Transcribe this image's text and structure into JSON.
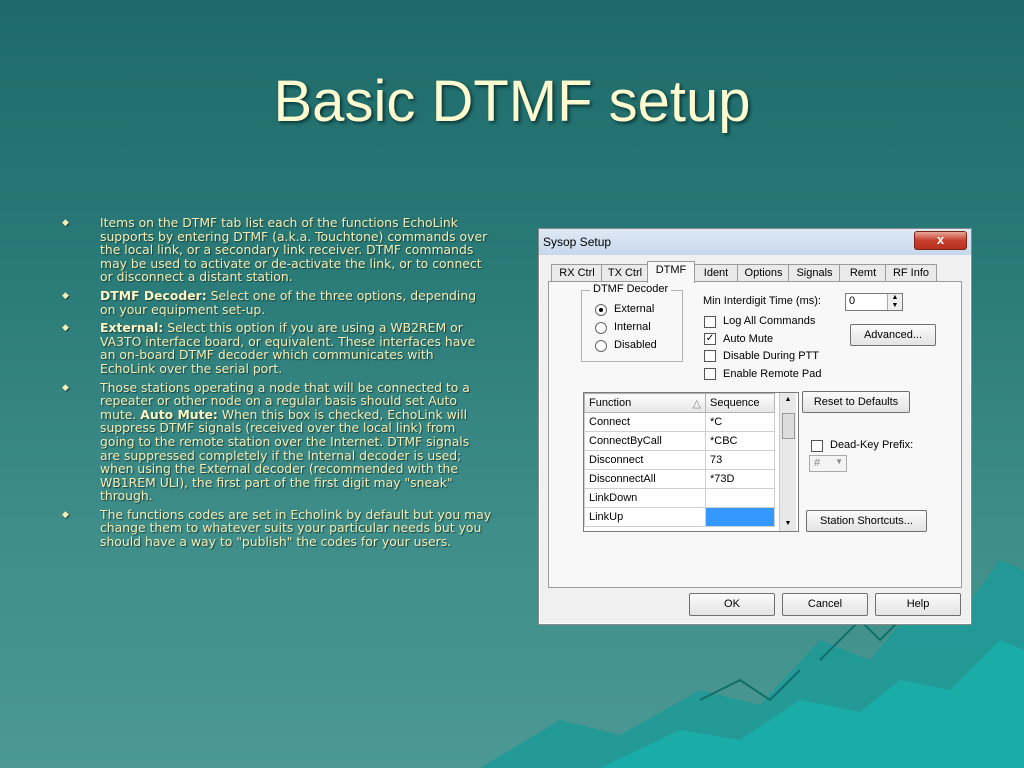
{
  "slide": {
    "title": "Basic DTMF setup",
    "bullets": [
      {
        "bold": "",
        "text": "Items on the DTMF tab list each of the functions EchoLink supports by entering DTMF (a.k.a. Touchtone) commands over the local link, or a secondary link receiver. DTMF commands may be used to activate or de-activate the link, or to connect or disconnect a distant station."
      },
      {
        "bold": "DTMF Decoder:",
        "text": " Select one of the three options, depending on your equipment set-up."
      },
      {
        "bold": "External:",
        "text": " Select this option if you are using a WB2REM or VA3TO interface board, or equivalent. These interfaces have an on-board DTMF decoder which communicates with EchoLink over the serial port."
      },
      {
        "bold": "",
        "text": "Those stations operating a node that will be connected to a repeater or other node on a regular basis should set Auto mute. ",
        "bold2": "Auto Mute:",
        "text2": " When this box is checked, EchoLink will suppress DTMF signals (received over the local link) from going to the remote station over the Internet. DTMF signals are suppressed completely if the Internal decoder is used; when using the External decoder (recommended with the WB1REM ULI), the first part of the first digit may \"sneak\" through."
      },
      {
        "bold": "",
        "text": "The functions codes are set in Echolink by default but you may change them to whatever suits your particular needs but you should have a way to \"publish\" the codes for your users."
      }
    ]
  },
  "dialog": {
    "title": "Sysop Setup",
    "close_label": "x",
    "tabs": [
      "RX Ctrl",
      "TX Ctrl",
      "DTMF",
      "Ident",
      "Options",
      "Signals",
      "Remt",
      "RF Info"
    ],
    "active_tab": "DTMF",
    "decoder_group": {
      "label": "DTMF Decoder",
      "options": [
        "External",
        "Internal",
        "Disabled"
      ],
      "selected": "External"
    },
    "min_interdigit_label": "Min Interdigit Time (ms):",
    "min_interdigit_value": "0",
    "checkboxes": [
      {
        "label": "Log All Commands",
        "checked": false
      },
      {
        "label": "Auto Mute",
        "checked": true
      },
      {
        "label": "Disable During PTT",
        "checked": false
      },
      {
        "label": "Enable Remote Pad",
        "checked": false
      }
    ],
    "advanced_label": "Advanced...",
    "table": {
      "headers": [
        "Function",
        "Sequence"
      ],
      "rows": [
        [
          "Connect",
          "*C"
        ],
        [
          "ConnectByCall",
          "*CBC"
        ],
        [
          "Disconnect",
          "73"
        ],
        [
          "DisconnectAll",
          "*73D"
        ],
        [
          "LinkDown",
          ""
        ],
        [
          "LinkUp",
          ""
        ]
      ]
    },
    "reset_label": "Reset to Defaults",
    "deadkey_label": "Dead-Key Prefix:",
    "deadkey_checked": false,
    "deadkey_value": "#",
    "shortcuts_label": "Station Shortcuts...",
    "ok_label": "OK",
    "cancel_label": "Cancel",
    "help_label": "Help"
  },
  "colors": {
    "title_text": "#fffbd0",
    "bullet_text": "#f4efb6",
    "background": "#2a7a78",
    "selected_cell": "#3399ff"
  }
}
